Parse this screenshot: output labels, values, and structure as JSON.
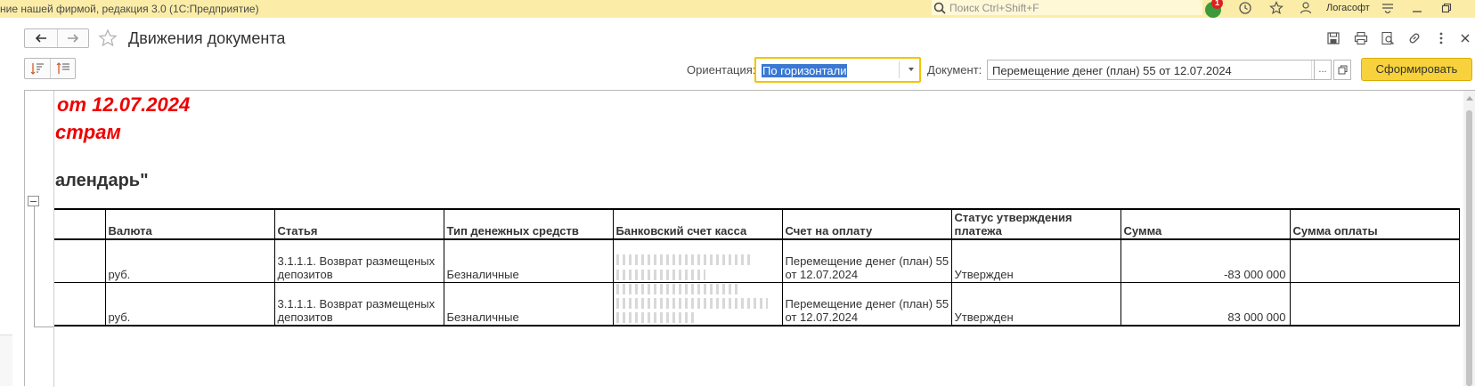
{
  "appbar": {
    "title": "ние нашей фирмой, редакция 3.0  (1С:Предприятие)",
    "search_placeholder": "Поиск Ctrl+Shift+F",
    "notification_count": "1",
    "user_name": "Логасофт"
  },
  "header": {
    "title": "Движения документа"
  },
  "toolbar": {
    "orientation_label": "Ориентация:",
    "orientation_value": "По горизонтали",
    "document_label": "Документ:",
    "document_value": "Перемещение денег (план) 55 от 12.07.2024",
    "more_label": "...",
    "generate_label": "Сформировать"
  },
  "report": {
    "title_line1": "от 12.07.2024",
    "title_line2": "страм",
    "subtitle": "алендарь\"",
    "columns": [
      "",
      "Валюта",
      "Статья",
      "Тип денежных средств",
      "Банковский счет касса",
      "Счет на оплату",
      "Статус утверждения платежа",
      "Сумма",
      "Сумма оплаты"
    ],
    "rows": [
      {
        "currency": "руб.",
        "article": "3.1.1.1. Возврат размещеных депозитов",
        "cash_type": "Безналичные",
        "invoice": "Перемещение денег (план) 55 от 12.07.2024",
        "status": "Утвержден",
        "amount": "-83 000 000",
        "paid": ""
      },
      {
        "currency": "руб.",
        "article": "3.1.1.1. Возврат размещеных депозитов",
        "cash_type": "Безналичные",
        "invoice": "Перемещение денег (план) 55 от 12.07.2024",
        "status": "Утвержден",
        "amount": "83 000 000",
        "paid": ""
      }
    ]
  }
}
